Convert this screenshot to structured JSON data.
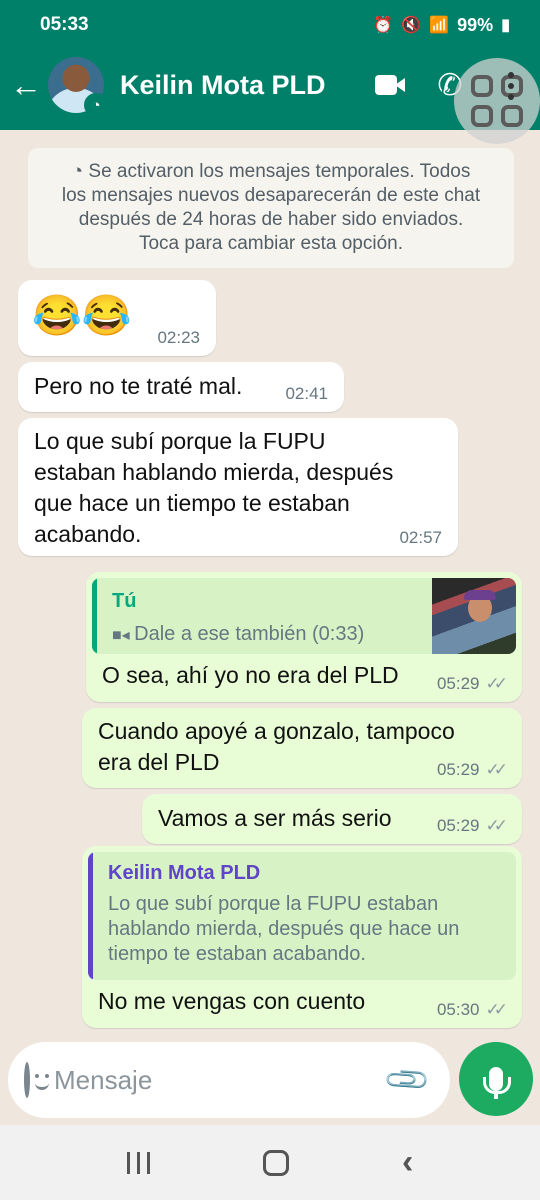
{
  "status_bar": {
    "time": "05:33",
    "battery": "99%"
  },
  "header": {
    "contact_name": "Keilin Mota PLD"
  },
  "notice": {
    "lines": [
      "Se activaron los mensajes temporales. Todos",
      "los mensajes nuevos desaparecerán de este chat",
      "después de 24 horas de haber sido enviados.",
      "Toca para cambiar esta opción."
    ]
  },
  "messages": [
    {
      "direction": "in",
      "text": "😂😂",
      "time": "02:23"
    },
    {
      "direction": "in",
      "text": "Pero no te traté mal.",
      "time": "02:41"
    },
    {
      "direction": "in",
      "lines": [
        "Lo que subí porque la FUPU",
        "estaban hablando mierda, después",
        "que hace un tiempo te estaban",
        "acabando."
      ],
      "time": "02:57"
    },
    {
      "direction": "out",
      "quote": {
        "author": "Tú",
        "text": "Dale a ese también (0:33)"
      },
      "text": "O sea, ahí yo no era del PLD",
      "time": "05:29"
    },
    {
      "direction": "out",
      "lines": [
        "Cuando apoyé a gonzalo, tampoco",
        "era del PLD"
      ],
      "time": "05:29"
    },
    {
      "direction": "out",
      "text": "Vamos a ser más serio",
      "time": "05:29"
    },
    {
      "direction": "out",
      "quote": {
        "author": "Keilin Mota PLD",
        "lines": [
          "Lo que subí porque la FUPU estaban",
          "hablando mierda, después que hace un",
          "tiempo te estaban acabando."
        ]
      },
      "text": "No me vengas con cuento",
      "time": "05:30"
    }
  ],
  "composer": {
    "placeholder": "Mensaje"
  },
  "colors": {
    "header": "#008069",
    "outgoing": "#e8fcd6",
    "incoming": "#ffffff",
    "mic": "#1daa61",
    "quote_self": "#06a77d",
    "quote_other": "#5f43c8"
  },
  "icons": [
    "back-arrow-icon",
    "timer-icon",
    "video-call-icon",
    "phone-icon",
    "more-options-icon",
    "emoji-icon",
    "attach-icon",
    "camera-icon",
    "mic-icon",
    "double-check-icon",
    "video-icon"
  ]
}
